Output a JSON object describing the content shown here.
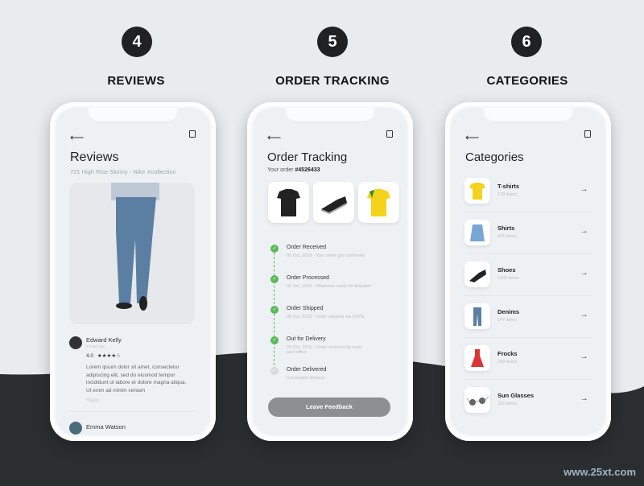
{
  "steps": [
    {
      "number": "4",
      "heading": "REVIEWS"
    },
    {
      "number": "5",
      "heading": "ORDER TRACKING"
    },
    {
      "number": "6",
      "heading": "CATEGORIES"
    }
  ],
  "reviews": {
    "title": "Reviews",
    "subtitle": "721 High Rise Skinny - Nike Xcollection",
    "items": [
      {
        "name": "Edward Kelly",
        "time": "2 hours ago",
        "rating": "4.0",
        "stars": "★★★★☆",
        "text": "Lorem ipsum dolor sit amet, consectetur adipiscing elit, sed do eiusmod tempor incididunt ut labore et dolore magna aliqua. Ut enim ad minim veniam",
        "reply": "Reply"
      },
      {
        "name": "Emma Watson"
      }
    ]
  },
  "tracking": {
    "title": "Order Tracking",
    "order_label": "Your order",
    "order_number": "#4526433",
    "steps": [
      {
        "title": "Order Received",
        "detail": "05 Oct, 2019 - Your order got confirmed",
        "done": true
      },
      {
        "title": "Order Processed",
        "detail": "06 Oct, 2019 - Shipment ready for dispatch",
        "done": true
      },
      {
        "title": "Order Shipped",
        "detail": "08 Oct, 2019 - Order shipped via USPS",
        "done": true
      },
      {
        "title": "Out for Delivery",
        "detail": "20 Oct, 2019 - Order received by local post office",
        "done": true
      },
      {
        "title": "Order Delivered",
        "detail": "Successful delivery",
        "done": false
      }
    ],
    "button": "Leave Feedback",
    "accent": "#5cb85c"
  },
  "categories": {
    "title": "Categories",
    "items": [
      {
        "name": "T-shirts",
        "count": "178 items"
      },
      {
        "name": "Shirts",
        "count": "475 items"
      },
      {
        "name": "Shoes",
        "count": "1102 items"
      },
      {
        "name": "Denims",
        "count": "147 items"
      },
      {
        "name": "Frocks",
        "count": "243 items"
      },
      {
        "name": "Sun Glasses",
        "count": "332 items"
      }
    ]
  },
  "watermark": "www.25xt.com"
}
